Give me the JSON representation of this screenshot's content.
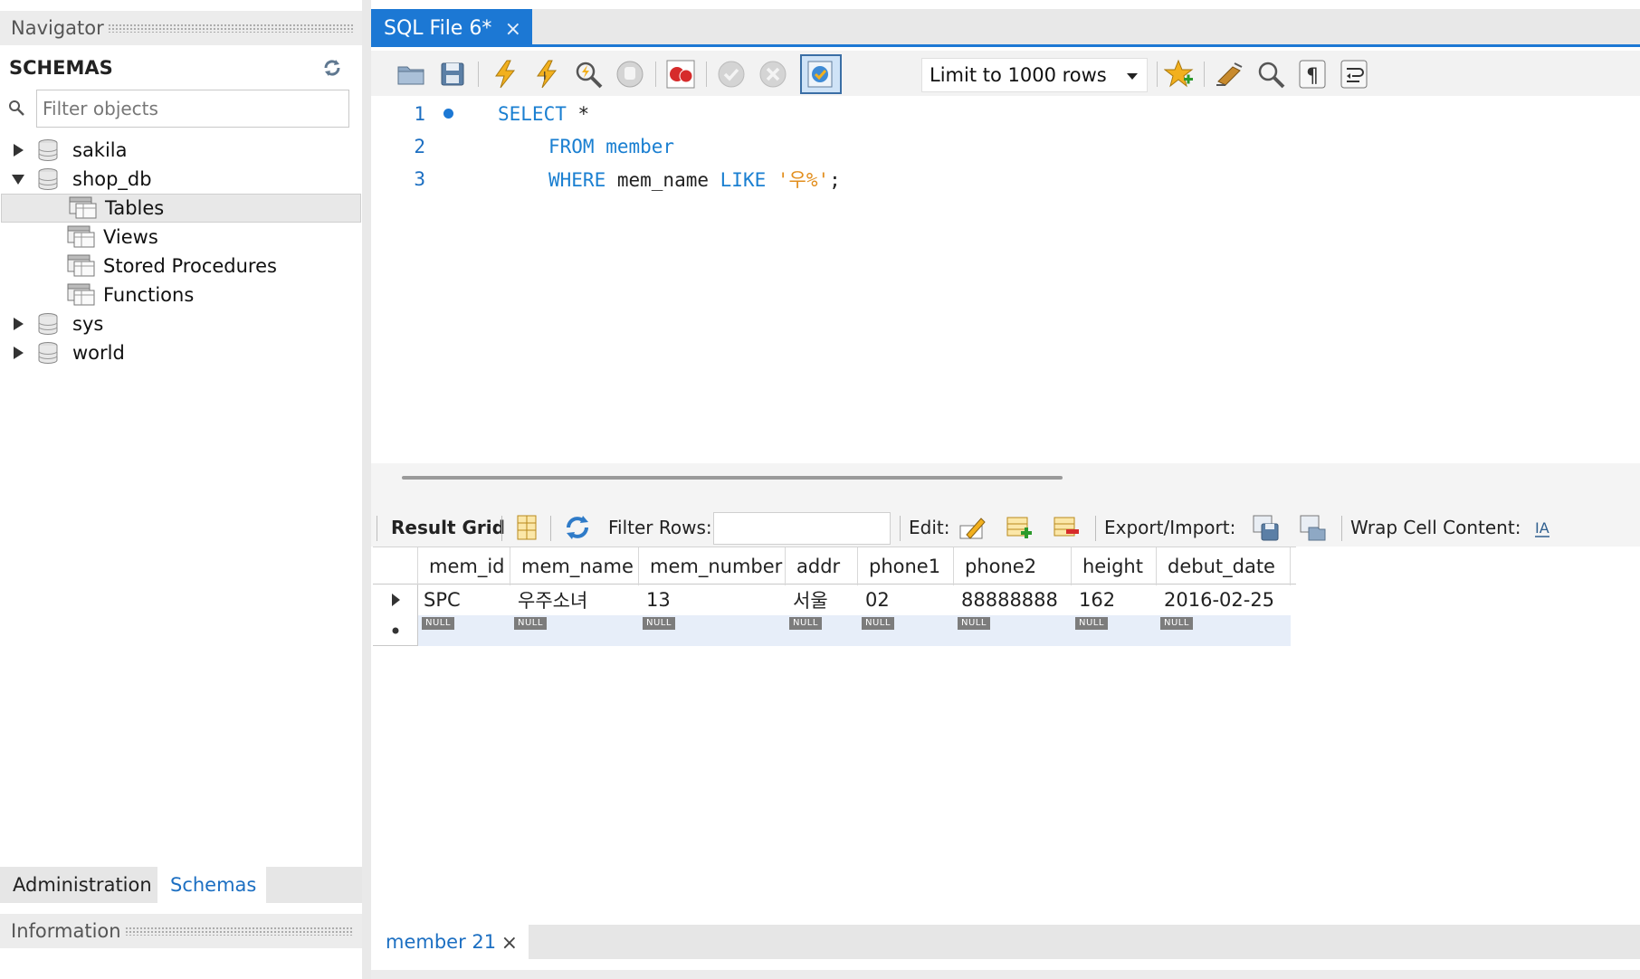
{
  "navigator": {
    "title": "Navigator",
    "schemas_label": "SCHEMAS",
    "filter_placeholder": "Filter objects",
    "tree": {
      "sakila": "sakila",
      "shop_db": "shop_db",
      "tables": "Tables",
      "views": "Views",
      "stored_procedures": "Stored Procedures",
      "functions": "Functions",
      "sys": "sys",
      "world": "world"
    },
    "tabs": {
      "administration": "Administration",
      "schemas": "Schemas"
    },
    "information": "Information"
  },
  "editor_tab": {
    "label": "SQL File 6*",
    "close": "×"
  },
  "toolbar": {
    "limit_label": "Limit to 1000 rows"
  },
  "editor": {
    "line_numbers": [
      "1",
      "2",
      "3"
    ],
    "line1": {
      "kw": "SELECT",
      "rest": " *"
    },
    "line2": {
      "kw": "FROM",
      "id": " member"
    },
    "line3": {
      "kw": "WHERE",
      "id": " mem_name ",
      "kw2": "LIKE",
      "str": " '우%'",
      "end": ";"
    }
  },
  "results_toolbar": {
    "result_grid": "Result Grid",
    "filter_rows": "Filter Rows:",
    "edit": "Edit:",
    "export_import": "Export/Import:",
    "wrap": "Wrap Cell Content:"
  },
  "grid": {
    "columns": [
      "mem_id",
      "mem_name",
      "mem_number",
      "addr",
      "phone1",
      "phone2",
      "height",
      "debut_date"
    ],
    "rows": [
      [
        "SPC",
        "우주소녀",
        "13",
        "서울",
        "02",
        "88888888",
        "162",
        "2016-02-25"
      ]
    ],
    "null_label": "NULL"
  },
  "bottom_tab": {
    "label": "member 21",
    "close": "×"
  },
  "colors": {
    "accent": "#1c78d4",
    "keyword": "#1a7fd1",
    "string": "#e28e1d"
  }
}
